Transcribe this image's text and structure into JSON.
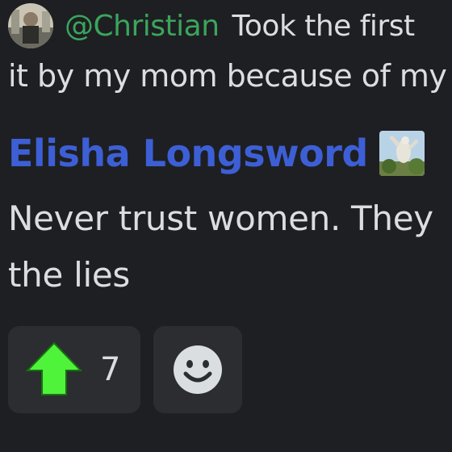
{
  "reply": {
    "author": "@Christian",
    "text_line1": "Took the first",
    "text_line2": "it by my mom because of my g"
  },
  "message": {
    "author": "Elisha Longsword",
    "author_color": "#3d5fd6",
    "role_icon": "statue-image-icon",
    "lines": [
      "Never trust women. They",
      "the lies"
    ]
  },
  "reactions": [
    {
      "icon": "green-up-arrow-icon",
      "count": "7"
    },
    {
      "icon": "add-reaction-smiley-icon"
    }
  ],
  "colors": {
    "background": "#1e1f22",
    "reaction_bg": "#2b2d31",
    "reply_author": "#3ba55d",
    "arrow": "#4ef33a"
  }
}
